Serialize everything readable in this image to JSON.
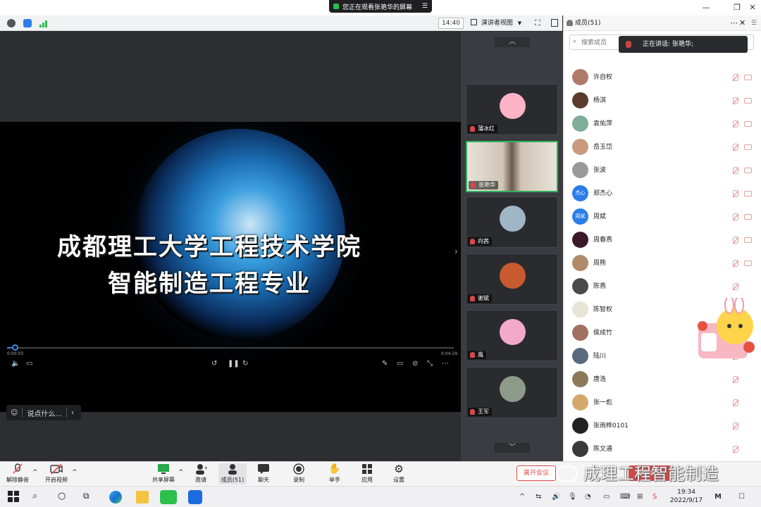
{
  "share_banner": {
    "text": "您正在观看张艳华的屏幕",
    "menu_icon": "list-icon"
  },
  "toolbar": {
    "time": "14:40",
    "view_mode": "演讲者视图"
  },
  "video": {
    "title_line1": "成都理工大学工程技术学院",
    "title_line2": "智能制造工程专业",
    "time_current": "0:00:03",
    "time_total": "0:04:29",
    "progress": 0.01
  },
  "chat": {
    "placeholder": "说点什么..."
  },
  "gallery": {
    "tiles": [
      {
        "name": "蒲冰红",
        "color": "#ffb3c7"
      },
      {
        "name": "张艳华",
        "color": "#d8c7b8"
      },
      {
        "name": "向茜",
        "color": "#9fb6c7"
      },
      {
        "name": "谢斌",
        "color": "#c85a2f"
      },
      {
        "name": "嵐",
        "color": "#f3a9c9"
      },
      {
        "name": "王军",
        "color": "#8d9c8a"
      }
    ]
  },
  "panel": {
    "title": "成员(51)",
    "search_placeholder": "搜索成员",
    "speaking_text": "正在讲话: 张艳华;",
    "members": [
      {
        "name": "许自权",
        "avatar_text": "",
        "color": "#b07a6a",
        "muted_cam": true
      },
      {
        "name": "杨淇",
        "avatar_text": "",
        "color": "#5a3a2a",
        "muted_cam": true
      },
      {
        "name": "袁佑萍",
        "avatar_text": "",
        "color": "#7fae9a",
        "muted_cam": true
      },
      {
        "name": "岳玉岱",
        "avatar_text": "",
        "color": "#c99a7f",
        "muted_cam": true
      },
      {
        "name": "张波",
        "avatar_text": "",
        "color": "#9a9a9a",
        "muted_cam": true
      },
      {
        "name": "郑杰心",
        "avatar_text": "杰心",
        "color": "#2b7de9",
        "muted_cam": true
      },
      {
        "name": "周斌",
        "avatar_text": "周斌",
        "color": "#2b7de9",
        "muted_cam": true
      },
      {
        "name": "周春燕",
        "avatar_text": "",
        "color": "#3a1a2a",
        "muted_cam": true
      },
      {
        "name": "周熊",
        "avatar_text": "",
        "color": "#b08a6a",
        "muted_cam": true
      },
      {
        "name": "陈燕",
        "avatar_text": "",
        "color": "#4a4a4a",
        "muted_cam": false
      },
      {
        "name": "陈智权",
        "avatar_text": "",
        "color": "#e9e4d8",
        "muted_cam": false
      },
      {
        "name": "侯成竹",
        "avatar_text": "",
        "color": "#a07060",
        "muted_cam": false
      },
      {
        "name": "陆川",
        "avatar_text": "",
        "color": "#5a6a7a",
        "muted_cam": false
      },
      {
        "name": "唐浩",
        "avatar_text": "",
        "color": "#8a7a5a",
        "muted_cam": false
      },
      {
        "name": "张一彪",
        "avatar_text": "",
        "color": "#d4a86a",
        "muted_cam": false
      },
      {
        "name": "张雨桦0101",
        "avatar_text": "",
        "color": "#222222",
        "muted_cam": false
      },
      {
        "name": "陈文通",
        "avatar_text": "",
        "color": "#3a3a3a",
        "muted_cam": false
      }
    ]
  },
  "controls": {
    "unmute": "解除静音",
    "start_video": "开启视频",
    "share": "共享屏幕",
    "invite": "邀请",
    "members": "成员(51)",
    "chat": "聊天",
    "record": "录制",
    "raise_hand": "举手",
    "apps": "应用",
    "settings": "设置",
    "leave": "离开会议",
    "end": "解散会议"
  },
  "watermark": "成理工程智能制造",
  "taskbar": {
    "time": "19:34",
    "date": "2022/9/17"
  }
}
